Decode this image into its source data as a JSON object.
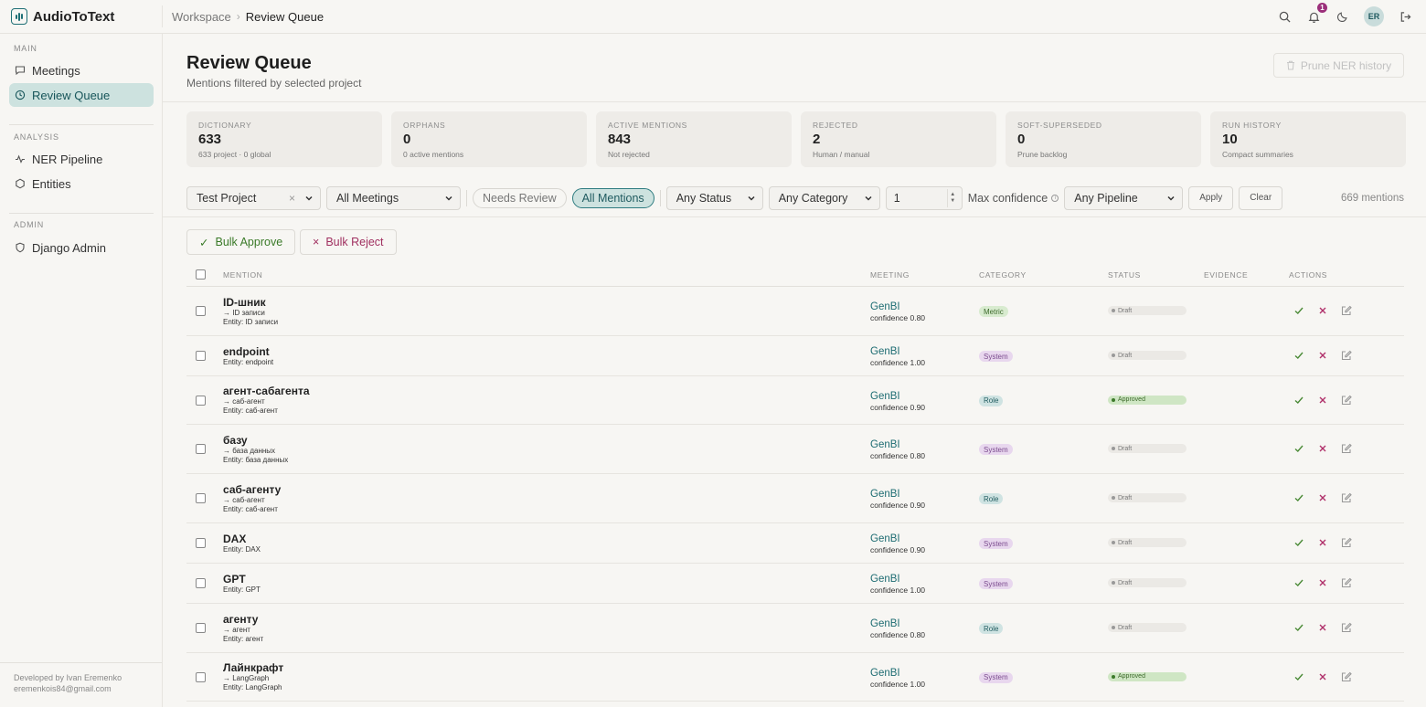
{
  "app": {
    "name": "AudioToText"
  },
  "breadcrumb": {
    "root": "Workspace",
    "separator": "›",
    "current": "Review Queue"
  },
  "topbar": {
    "notification_count": "1",
    "avatar_initials": "ER",
    "icons": [
      "search-icon",
      "bell-icon",
      "moon-icon",
      "logout-icon"
    ]
  },
  "sidebar": {
    "sections": [
      {
        "label": "MAIN",
        "items": [
          {
            "label": "Meetings",
            "icon": "chat-icon",
            "active": false
          },
          {
            "label": "Review Queue",
            "icon": "clock-icon",
            "active": true
          }
        ]
      },
      {
        "label": "ANALYSIS",
        "items": [
          {
            "label": "NER Pipeline",
            "icon": "pulse-icon",
            "active": false
          },
          {
            "label": "Entities",
            "icon": "hexagon-icon",
            "active": false
          }
        ]
      },
      {
        "label": "ADMIN",
        "items": [
          {
            "label": "Django Admin",
            "icon": "shield-icon",
            "active": false
          }
        ]
      }
    ],
    "footer": {
      "line1": "Developed by Ivan Eremenko",
      "line2": "eremenkois84@gmail.com"
    }
  },
  "page": {
    "title": "Review Queue",
    "subtitle": "Mentions filtered by selected project",
    "prune_label": "Prune NER history"
  },
  "stats": [
    {
      "label": "DICTIONARY",
      "value": "633",
      "sub": "633 project · 0 global"
    },
    {
      "label": "ORPHANS",
      "value": "0",
      "sub": "0 active mentions"
    },
    {
      "label": "ACTIVE MENTIONS",
      "value": "843",
      "sub": "Not rejected"
    },
    {
      "label": "REJECTED",
      "value": "2",
      "sub": "Human / manual"
    },
    {
      "label": "SOFT-SUPERSEDED",
      "value": "0",
      "sub": "Prune backlog"
    },
    {
      "label": "RUN HISTORY",
      "value": "10",
      "sub": "Compact summaries"
    }
  ],
  "filters": {
    "project": "Test Project",
    "meetings": "All Meetings",
    "needs_review": "Needs Review",
    "all_mentions": "All Mentions",
    "status": "Any Status",
    "category": "Any Category",
    "min_value": "1",
    "max_confidence_label": "Max confidence",
    "pipeline": "Any Pipeline",
    "apply": "Apply",
    "clear": "Clear",
    "count": "669 mentions"
  },
  "bulk": {
    "approve": "Bulk Approve",
    "reject": "Bulk Reject",
    "approve_icon": "✓",
    "reject_icon": "×"
  },
  "table": {
    "columns": {
      "mention": "MENTION",
      "meeting": "MEETING",
      "category": "CATEGORY",
      "status": "STATUS",
      "evidence": "EVIDENCE",
      "actions": "ACTIONS"
    },
    "rows": [
      {
        "mention": "ID-шник",
        "lines": [
          "→ ID записи",
          "Entity: ID записи"
        ],
        "meeting": "GenBI",
        "confidence": "confidence 0.80",
        "category": "Metric",
        "cat_class": "metric",
        "status": "Draft",
        "status_class": "draft"
      },
      {
        "mention": "endpoint",
        "lines": [
          "Entity: endpoint"
        ],
        "meeting": "GenBI",
        "confidence": "confidence 1.00",
        "category": "System",
        "cat_class": "system",
        "status": "Draft",
        "status_class": "draft"
      },
      {
        "mention": "агент-сабагента",
        "lines": [
          "→ саб-агент",
          "Entity: саб-агент"
        ],
        "meeting": "GenBI",
        "confidence": "confidence 0.90",
        "category": "Role",
        "cat_class": "role",
        "status": "Approved",
        "status_class": "approved"
      },
      {
        "mention": "базу",
        "lines": [
          "→ база данных",
          "Entity: база данных"
        ],
        "meeting": "GenBI",
        "confidence": "confidence 0.80",
        "category": "System",
        "cat_class": "system",
        "status": "Draft",
        "status_class": "draft"
      },
      {
        "mention": "саб-агенту",
        "lines": [
          "→ саб-агент",
          "Entity: саб-агент"
        ],
        "meeting": "GenBI",
        "confidence": "confidence 0.90",
        "category": "Role",
        "cat_class": "role",
        "status": "Draft",
        "status_class": "draft"
      },
      {
        "mention": "DAX",
        "lines": [
          "Entity: DAX"
        ],
        "meeting": "GenBI",
        "confidence": "confidence 0.90",
        "category": "System",
        "cat_class": "system",
        "status": "Draft",
        "status_class": "draft"
      },
      {
        "mention": "GPT",
        "lines": [
          "Entity: GPT"
        ],
        "meeting": "GenBI",
        "confidence": "confidence 1.00",
        "category": "System",
        "cat_class": "system",
        "status": "Draft",
        "status_class": "draft"
      },
      {
        "mention": "агенту",
        "lines": [
          "→ агент",
          "Entity: агент"
        ],
        "meeting": "GenBI",
        "confidence": "confidence 0.80",
        "category": "Role",
        "cat_class": "role",
        "status": "Draft",
        "status_class": "draft"
      },
      {
        "mention": "Лайнкрафт",
        "lines": [
          "→ LangGraph",
          "Entity: LangGraph"
        ],
        "meeting": "GenBI",
        "confidence": "confidence 1.00",
        "category": "System",
        "cat_class": "system",
        "status": "Approved",
        "status_class": "approved"
      }
    ]
  },
  "colors": {
    "accent": "#1f6f75",
    "active_bg": "#cde2df",
    "approve": "#3a7a28",
    "reject": "#a03060",
    "notif": "#9b2f7a"
  }
}
